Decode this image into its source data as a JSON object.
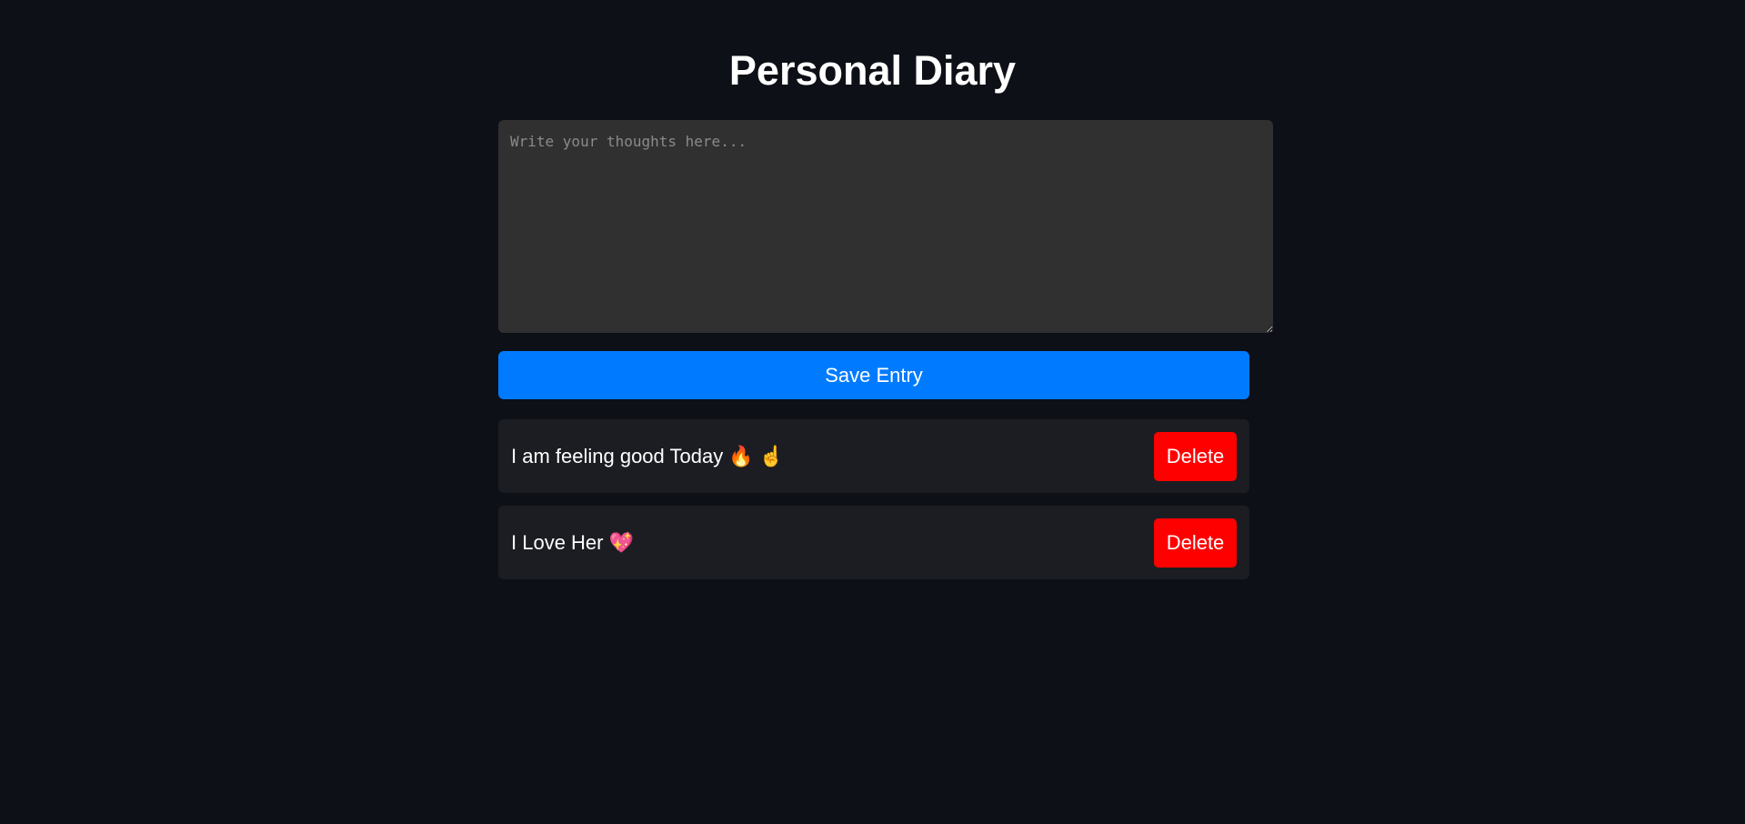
{
  "header": {
    "title": "Personal Diary"
  },
  "editor": {
    "placeholder": "Write your thoughts here...",
    "value": ""
  },
  "actions": {
    "save_label": "Save Entry"
  },
  "entries": [
    {
      "text": "I am feeling good Today 🔥 ☝️",
      "delete_label": "Delete"
    },
    {
      "text": "I Love Her 💖",
      "delete_label": "Delete"
    }
  ],
  "colors": {
    "background": "#0d1016",
    "editor_background": "#303030",
    "save_button": "#007bff",
    "entry_background": "#1b1d22",
    "delete_button": "#ff0000"
  }
}
